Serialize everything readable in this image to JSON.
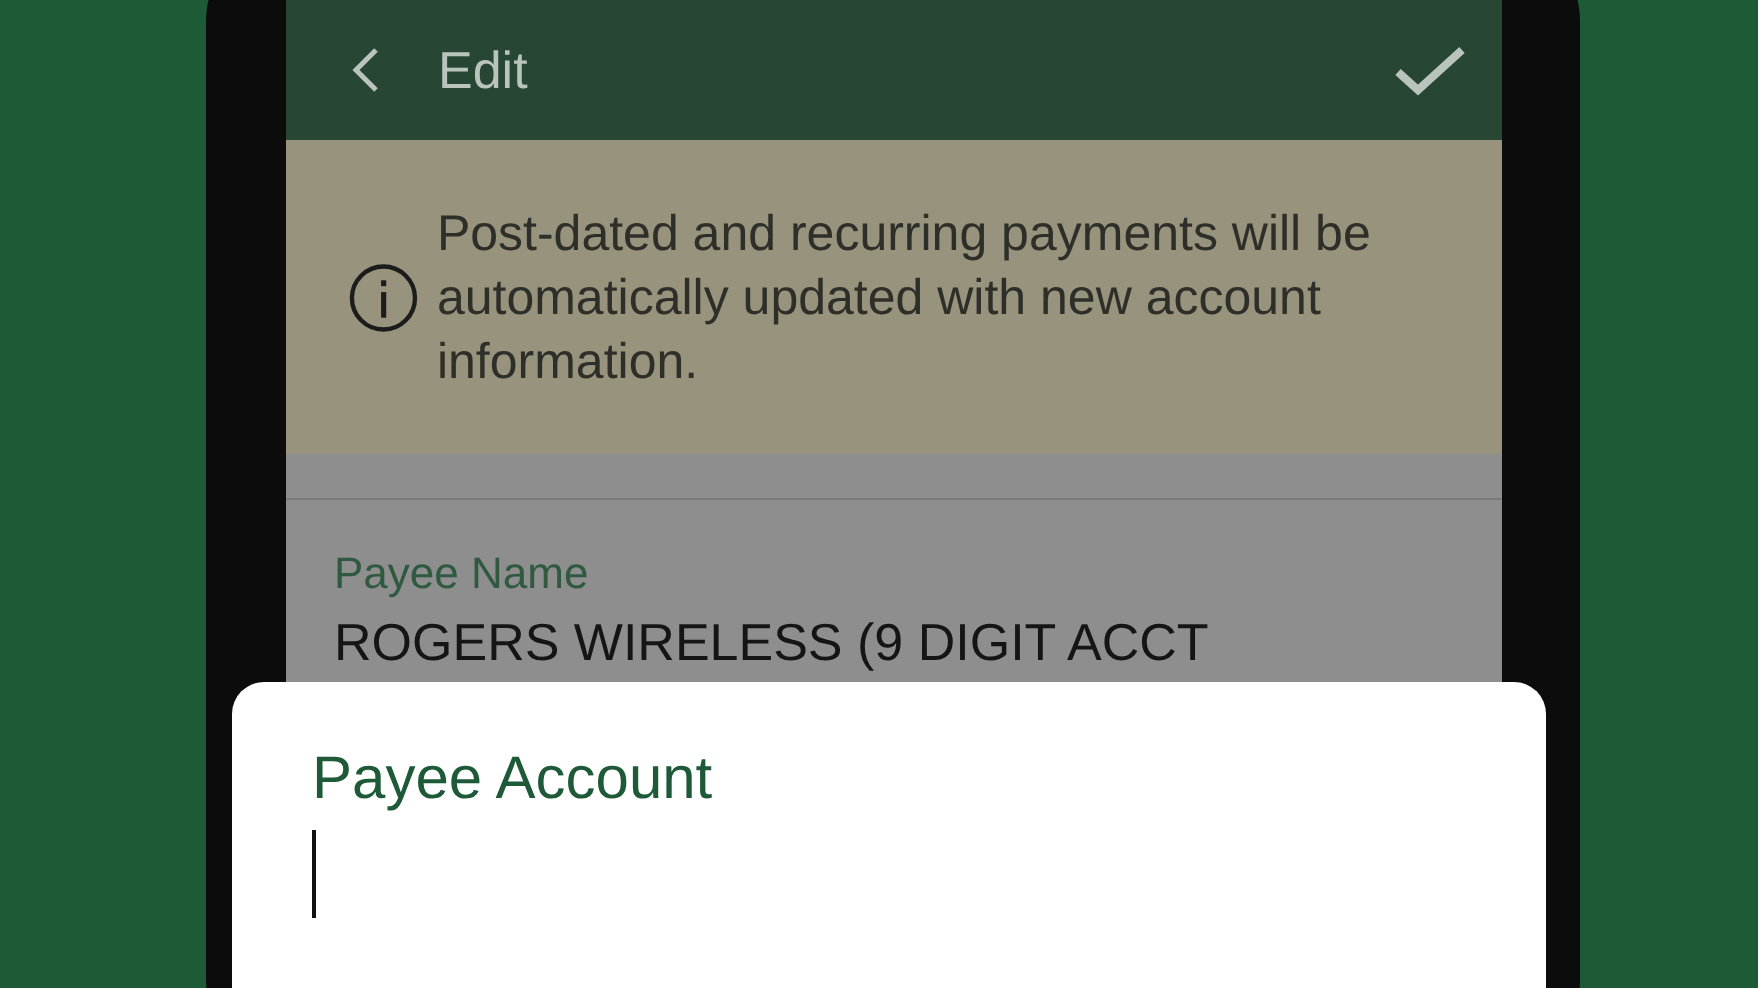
{
  "header": {
    "title": "Edit"
  },
  "notice": {
    "text": "Post-dated and recurring payments will be automatically updated with new account information."
  },
  "fields": [
    {
      "label": "Payee Name",
      "value": "ROGERS WIRELESS (9 DIGIT ACCT"
    }
  ],
  "sheet": {
    "label": "Payee Account"
  }
}
